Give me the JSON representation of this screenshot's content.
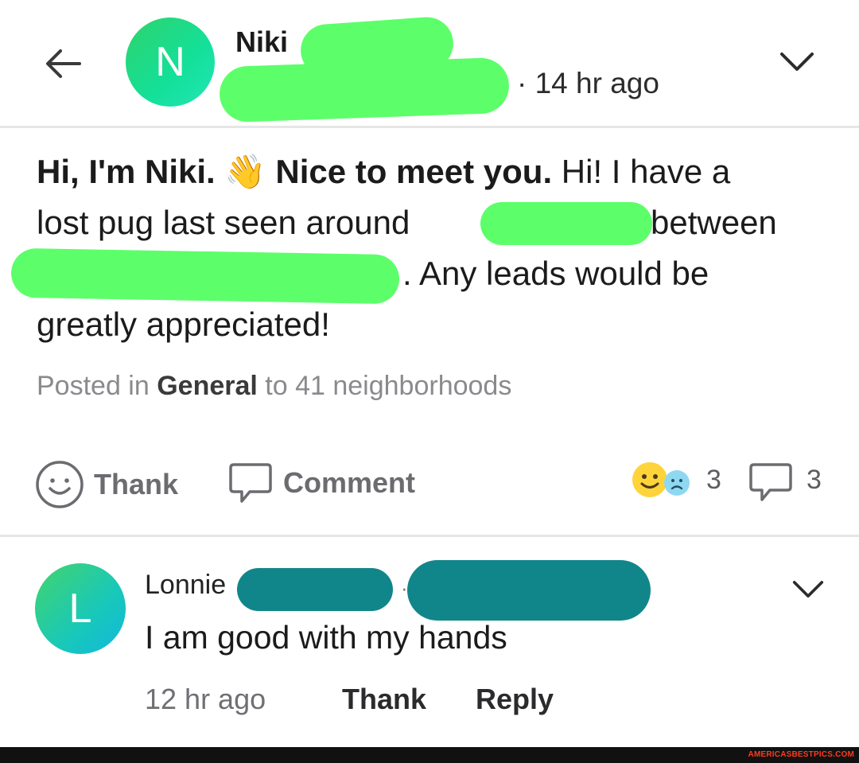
{
  "header": {
    "author_initial": "N",
    "author_name": "Niki",
    "time": "14 hr ago"
  },
  "post": {
    "line1_bold": "Hi, I'm Niki.",
    "line1_emoji": "👋",
    "line1_bold2": "Nice to meet you.",
    "line1_rest": " Hi! I have a",
    "line2_a": "lost  pug last seen around",
    "line2_b": "between",
    "line3": ". Any leads would be",
    "line4": "greatly appreciated!",
    "posted_prefix": "Posted in ",
    "posted_category": "General",
    "posted_suffix": " to 41 neighborhoods"
  },
  "actions": {
    "thank_label": "Thank",
    "comment_label": "Comment",
    "reaction_count": "3",
    "comment_count": "3"
  },
  "comment": {
    "author_initial": "L",
    "author_name": "Lonnie",
    "dot": "·",
    "text": "I am good with my hands",
    "time": "12 hr ago",
    "thank_label": "Thank",
    "reply_label": "Reply"
  },
  "footer": {
    "watermark": "AMERICASBESTPICS.COM"
  },
  "colors": {
    "redaction_green": "#5cff6a",
    "redaction_teal": "#11868a"
  }
}
